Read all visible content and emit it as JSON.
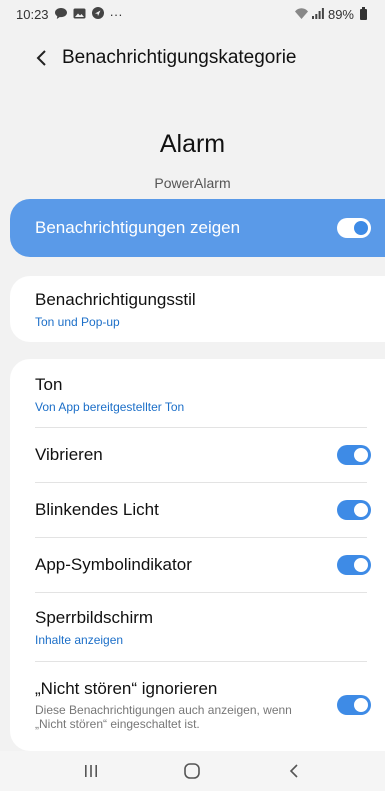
{
  "status_bar": {
    "time": "10:23",
    "more": "···",
    "battery": "89%"
  },
  "header": {
    "title": "Benachrichtigungskategorie",
    "back_icon": "chevron-left-icon"
  },
  "app": {
    "title": "Alarm",
    "subtitle": "PowerAlarm"
  },
  "master": {
    "label": "Benachrichtigungen zeigen",
    "enabled": true
  },
  "style": {
    "title": "Benachrichtigungsstil",
    "value": "Ton und Pop-up"
  },
  "settings": {
    "sound": {
      "title": "Ton",
      "value": "Von App bereitgestellter Ton"
    },
    "vibrate": {
      "title": "Vibrieren",
      "enabled": true
    },
    "blink": {
      "title": "Blinkendes Licht",
      "enabled": true
    },
    "badge": {
      "title": "App-Symbolindikator",
      "enabled": true
    },
    "lockscreen": {
      "title": "Sperrbildschirm",
      "value": "Inhalte anzeigen"
    },
    "dnd": {
      "title": "„Nicht stören“ ignorieren",
      "description": "Diese Benachrichtigungen auch anzeigen, wenn „Nicht stören“ eingeschaltet ist.",
      "enabled": true
    }
  },
  "colors": {
    "accent": "#3e8be6",
    "master_bg": "#5a9ae8",
    "link": "#1c6fc8",
    "background": "#f2f2f2"
  },
  "navbar": {
    "recent": "recent-apps-icon",
    "home": "home-icon",
    "back": "back-icon"
  }
}
